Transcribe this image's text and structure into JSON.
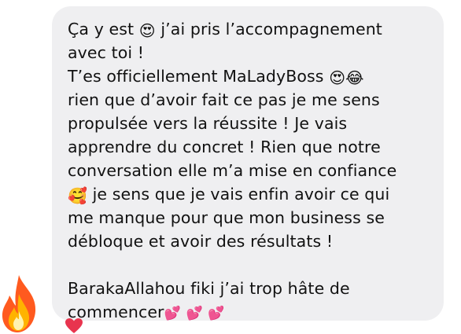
{
  "message": {
    "line1_before": "Ça y est ",
    "line1_emoji": "😍",
    "line1_after": " j’ai pris l’accompagnement",
    "line2": "avec toi !",
    "line3_text": "T’es officiellement MaLadyBoss ",
    "line3_emoji_a": "😍",
    "line3_emoji_b": "😂",
    "line4": "rien que d’avoir fait ce pas je me sens",
    "line5": "propulsée vers la réussite ! Je vais",
    "line6": "apprendre du concret ! Rien que notre",
    "line7": "conversation elle m’a mise en confiance",
    "line8_emoji": "🥰",
    "line8_text": " je sens que je vais enfin avoir ce qui",
    "line9": "me manque pour que mon business se",
    "line10": "débloque et avoir des résultats !",
    "line11": "BarakaAllahou fiki j’ai trop hâte de",
    "line12_text": "commencer",
    "line12_emojis": [
      "💕",
      "💕",
      "💕"
    ]
  },
  "reactions": {
    "fire_icon": "fire-icon",
    "heart_icon": "heart-icon"
  },
  "colors": {
    "bubble_background": "#efeff1",
    "text": "#111111"
  }
}
